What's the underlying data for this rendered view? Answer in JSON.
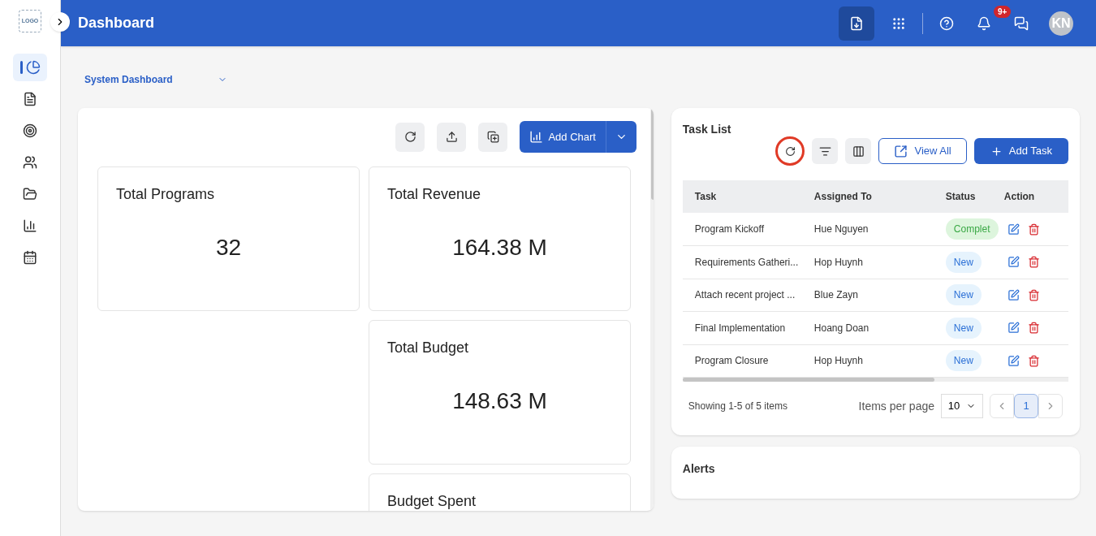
{
  "logo": "LOGO",
  "header": {
    "title": "Dashboard",
    "notifications_badge": "9+",
    "avatar": "KN"
  },
  "sidebar": {
    "items": [
      {
        "selected": true
      },
      {
        "selected": false
      },
      {
        "selected": false
      },
      {
        "selected": false
      },
      {
        "selected": false
      },
      {
        "selected": false
      },
      {
        "selected": false
      }
    ]
  },
  "dashboard_select": {
    "value": "System Dashboard"
  },
  "chart_toolbar": {
    "add_button": "Add Chart"
  },
  "left_cards": [
    {
      "title": "Total Programs",
      "value": "32"
    }
  ],
  "right_cards": [
    {
      "title": "Total Revenue",
      "value": "164.38 M"
    },
    {
      "title": "Total Budget",
      "value": "148.63 M"
    },
    {
      "title": "Budget Spent"
    }
  ],
  "task_list": {
    "title": "Task List",
    "refresh_highlighted": true,
    "view_all": "View All",
    "add_task": "Add Task",
    "columns": [
      "Task",
      "Assigned To",
      "Status",
      "Action"
    ],
    "rows": [
      {
        "task": "Program Kickoff",
        "assigned_to": "Hue Nguyen",
        "status": "Complet",
        "kind": "complete"
      },
      {
        "task": "Requirements Gatheri...",
        "assigned_to": "Hop Huynh",
        "status": "New",
        "kind": "new"
      },
      {
        "task": "Attach recent project ...",
        "assigned_to": "Blue Zayn",
        "status": "New",
        "kind": "new"
      },
      {
        "task": "Final Implementation",
        "assigned_to": "Hoang Doan",
        "status": "New",
        "kind": "new"
      },
      {
        "task": "Program Closure",
        "assigned_to": "Hop Huynh",
        "status": "New",
        "kind": "new"
      }
    ],
    "summary": "Showing 1-5 of 5 items",
    "per_page_label": "Items per page",
    "per_page": "10",
    "pages": [
      {
        "label": "1",
        "selected": true
      }
    ]
  },
  "alerts": {
    "title": "Alerts"
  }
}
